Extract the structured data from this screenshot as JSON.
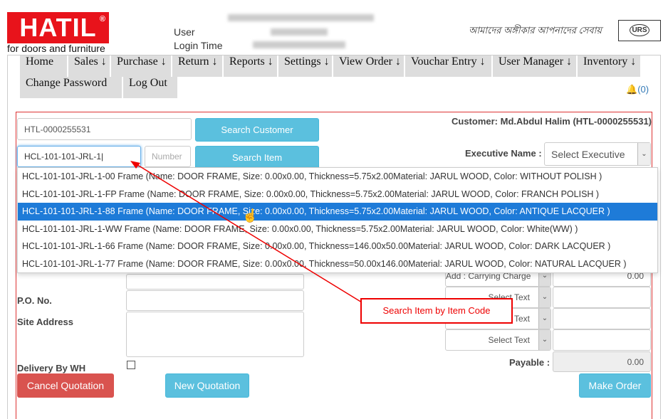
{
  "header": {
    "logo": "HATIL",
    "logo_mark": "®",
    "tagline": "for doors and furniture",
    "user_label": "User",
    "login_time_label": "Login Time",
    "slogan": "আমাদের অঙ্গীকার আপনাদের সেবায়",
    "cert": "URS"
  },
  "menu": {
    "row1": [
      "Home",
      "Sales ↓",
      "Purchase ↓",
      "Return ↓",
      "Reports ↓",
      "Settings ↓",
      "View Order ↓",
      "Vouchar Entry ↓",
      "User Manager ↓",
      "Inventory ↓"
    ],
    "row2": [
      "Change Password",
      "Log Out"
    ],
    "notifications": "(0)"
  },
  "form": {
    "customer_code": "HTL-0000255531",
    "search_customer": "Search Customer",
    "customer_info": "Customer: Md.Abdul Halim (HTL-0000255531)",
    "item_code": "HCL-101-101-JRL-1",
    "number_placeholder": "Number",
    "search_item": "Search Item",
    "executive_label": "Executive Name :",
    "executive_value": "Select Executive",
    "po_label": "P.O. No.",
    "site_label": "Site Address",
    "delivery_label": "Delivery By WH",
    "charges": [
      {
        "label": "Add : Carrying Charge",
        "value": "0.00"
      },
      {
        "label": "Select Text",
        "value": ""
      },
      {
        "label": "Select Text",
        "value": ""
      },
      {
        "label": "Select Text",
        "value": ""
      }
    ],
    "payable_label": "Payable :",
    "payable_value": "0.00",
    "cancel": "Cancel Quotation",
    "new": "New Quotation",
    "make": "Make Order"
  },
  "suggestions": [
    "HCL-101-101-JRL-1-00 Frame (Name: DOOR FRAME, Size: 0.00x0.00, Thickness=5.75x2.00Material: JARUL WOOD, Color: WITHOUT POLISH )",
    "HCL-101-101-JRL-1-FP Frame (Name: DOOR FRAME, Size: 0.00x0.00, Thickness=5.75x2.00Material: JARUL WOOD, Color: FRANCH POLISH )",
    "HCL-101-101-JRL-1-88 Frame (Name: DOOR FRAME, Size: 0.00x0.00, Thickness=5.75x2.00Material: JARUL WOOD, Color: ANTIQUE LACQUER )",
    "HCL-101-101-JRL-1-WW Frame (Name: DOOR FRAME, Size: 0.00x0.00, Thickness=5.75x2.00Material: JARUL WOOD, Color: White(WW) )",
    "HCL-101-101-JRL-1-66 Frame (Name: DOOR FRAME, Size: 0.00x0.00, Thickness=146.00x50.00Material: JARUL WOOD, Color: DARK LACQUER )",
    "HCL-101-101-JRL-1-77 Frame (Name: DOOR FRAME, Size: 0.00x0.00, Thickness=50.00x146.00Material: JARUL WOOD, Color: NATURAL LACQUER )"
  ],
  "annotation": "Search Item by Item Code"
}
